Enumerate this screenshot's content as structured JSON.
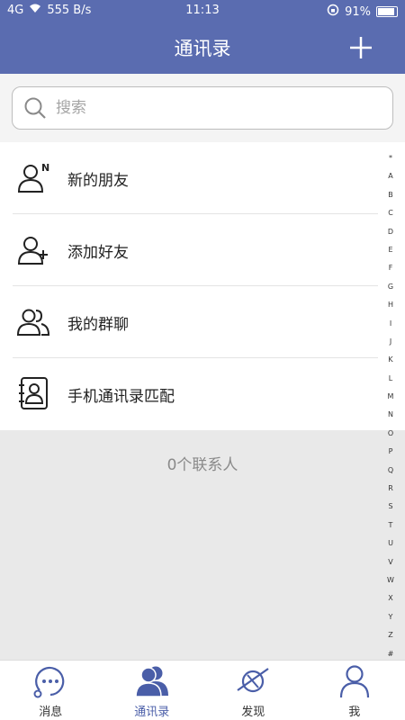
{
  "status": {
    "signal": "4G",
    "speed": "555 B/s",
    "time": "11:13",
    "battery": "91%"
  },
  "header": {
    "title": "通讯录"
  },
  "search": {
    "placeholder": "搜索"
  },
  "menu": [
    {
      "label": "新的朋友",
      "icon": "new-friend-icon"
    },
    {
      "label": "添加好友",
      "icon": "add-friend-icon"
    },
    {
      "label": "我的群聊",
      "icon": "group-chat-icon"
    },
    {
      "label": "手机通讯录匹配",
      "icon": "phone-contacts-icon"
    }
  ],
  "contacts_count": "0个联系人",
  "index": [
    "*",
    "A",
    "B",
    "C",
    "D",
    "E",
    "F",
    "G",
    "H",
    "I",
    "J",
    "K",
    "L",
    "M",
    "N",
    "O",
    "P",
    "Q",
    "R",
    "S",
    "T",
    "U",
    "V",
    "W",
    "X",
    "Y",
    "Z",
    "#"
  ],
  "tabs": [
    {
      "label": "消息",
      "icon": "message-icon"
    },
    {
      "label": "通讯录",
      "icon": "contacts-icon",
      "active": true
    },
    {
      "label": "发现",
      "icon": "discover-icon"
    },
    {
      "label": "我",
      "icon": "me-icon"
    }
  ],
  "colors": {
    "primary": "#5a6cb0",
    "active_tab": "#4a5ea8"
  }
}
